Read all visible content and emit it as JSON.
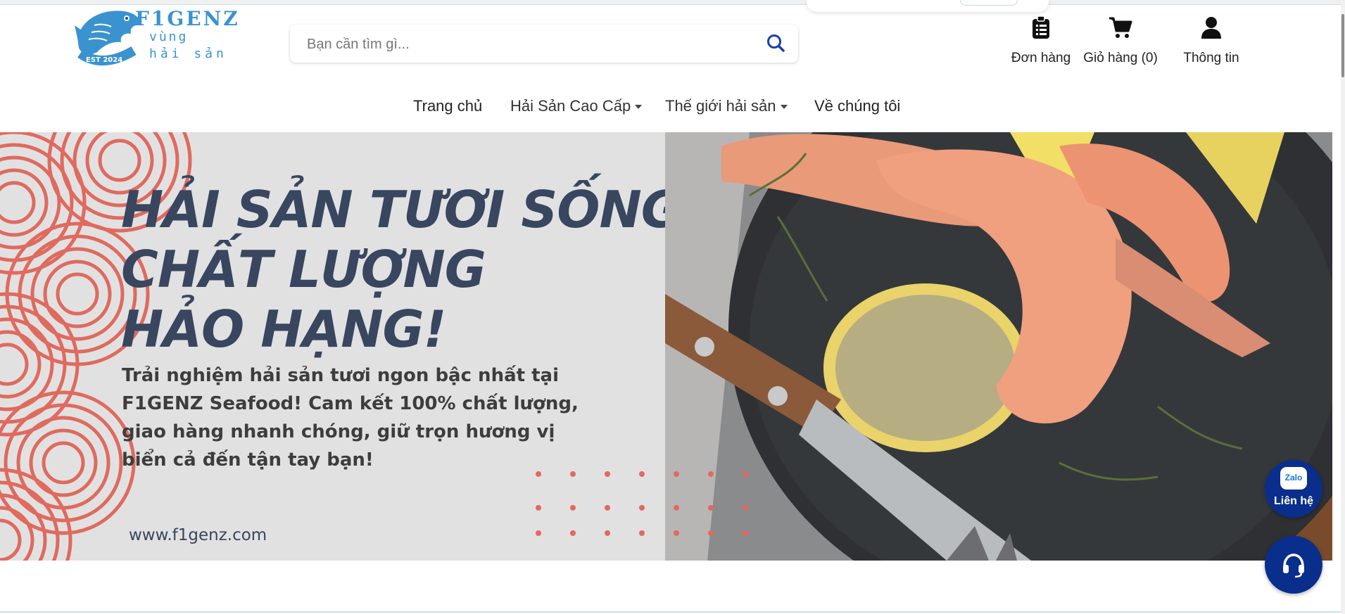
{
  "logo": {
    "brand": "F1GENZ",
    "line1": "vùng",
    "line2": "hải sản",
    "est": "EST 2024"
  },
  "search": {
    "placeholder": "Bạn cần tìm gì..."
  },
  "header_icons": {
    "orders": "Đơn hàng",
    "cart": "Giỏ hàng (0)",
    "account": "Thông tin"
  },
  "nav": {
    "items": [
      {
        "label": "Trang chủ",
        "dropdown": false
      },
      {
        "label": "Hải Sản Cao Cấp",
        "dropdown": true
      },
      {
        "label": "Thế giới hải sản",
        "dropdown": true
      },
      {
        "label": "Về chúng tôi",
        "dropdown": false
      }
    ]
  },
  "banner": {
    "headline": [
      "HẢI SẢN TƯƠI SỐNG",
      "CHẤT LƯỢNG",
      "HẢO HẠNG!"
    ],
    "tagline": "Trải nghiệm hải sản tươi ngon bậc nhất tại F1GENZ Seafood! Cam kết 100% chất lượng, giao hàng nhanh chóng, giữ trọn hương vị biển cả đến tận tay bạn!",
    "website": "www.f1genz.com"
  },
  "floating": {
    "zalo_badge": "Zalo",
    "zalo_label": "Liên hệ"
  },
  "colors": {
    "brand": "#3a93cf",
    "headline": "#38465f",
    "wave": "#e06a5e",
    "float_button": "#0a2e8c",
    "search_icon": "#1c3faa"
  }
}
